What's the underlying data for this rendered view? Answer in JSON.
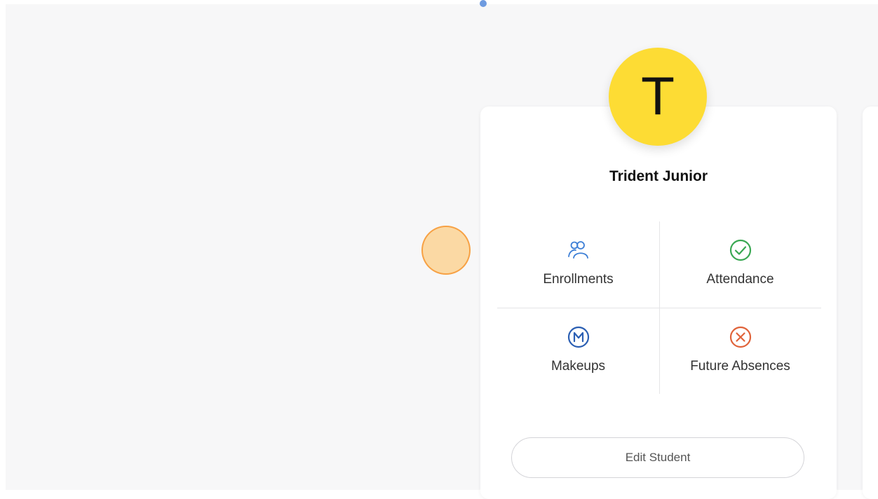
{
  "student": {
    "initial": "T",
    "name": "Trident Junior",
    "avatar_color": "#fddc34"
  },
  "actions": [
    {
      "label": "Enrollments",
      "icon": "people-icon",
      "color": "#3d7fd6"
    },
    {
      "label": "Attendance",
      "icon": "check-circle-icon",
      "color": "#3aa853"
    },
    {
      "label": "Makeups",
      "icon": "makeup-m-icon",
      "color": "#2b5fb3"
    },
    {
      "label": "Future Absences",
      "icon": "x-circle-icon",
      "color": "#e0633a"
    }
  ],
  "edit_button_label": "Edit Student"
}
